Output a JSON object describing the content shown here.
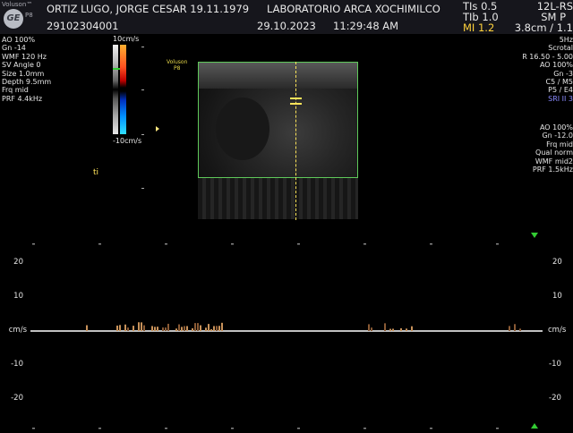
{
  "header": {
    "brand": "Voluson™",
    "model": "P8",
    "logo": "GE",
    "patient": "ORTIZ LUGO, JORGE CESAR 19.11.1979",
    "patient_id": "29102304001",
    "institution": "LABORATORIO ARCA XOCHIMILCO",
    "date": "29.10.2023",
    "time": "11:29:48 AM",
    "tis": "TIs 0.5",
    "tib": "TIb 1.0",
    "mi": "MI 1.2",
    "probe": "12L-RS",
    "preset": "SM P",
    "depth": "3.8cm / 1.1"
  },
  "left_params": [
    "AO 100%",
    "Gn -14",
    "WMF 120 Hz",
    "SV Angle  0",
    "Size  1.0mm",
    "Depth  9.5mm",
    "Frq mid",
    "PRF  4.4kHz"
  ],
  "color_bar": {
    "top": "10cm/s",
    "bottom": "-10cm/s"
  },
  "image_overlay": {
    "brand": "Voluson",
    "model": "P8"
  },
  "cursor_marker": "ti",
  "right_params_top": [
    "5Hz",
    "Scrotal",
    "R 16.50 - 5.00",
    "AO 100%",
    "Gn  -3",
    "C5 / M5",
    "P5 / E4"
  ],
  "sri": "SRI II 3",
  "right_params_bottom": [
    "AO 100%",
    "Gn -12.0",
    "Frq mid",
    "Qual norm",
    "WMF mid2",
    "PRF  1.5kHz"
  ],
  "spectral": {
    "unit": "cm/s",
    "ticks_left": [
      "20",
      "10",
      "-10",
      "-20"
    ],
    "ticks_right": [
      "20",
      "10",
      "-10",
      "-20"
    ],
    "scale_max": 25,
    "scale_min": -25
  },
  "colors": {
    "roi_box": "#5fc95a",
    "cursor": "#ffe45a",
    "header_bg": "#16161c",
    "mi": "#ffd23c"
  }
}
